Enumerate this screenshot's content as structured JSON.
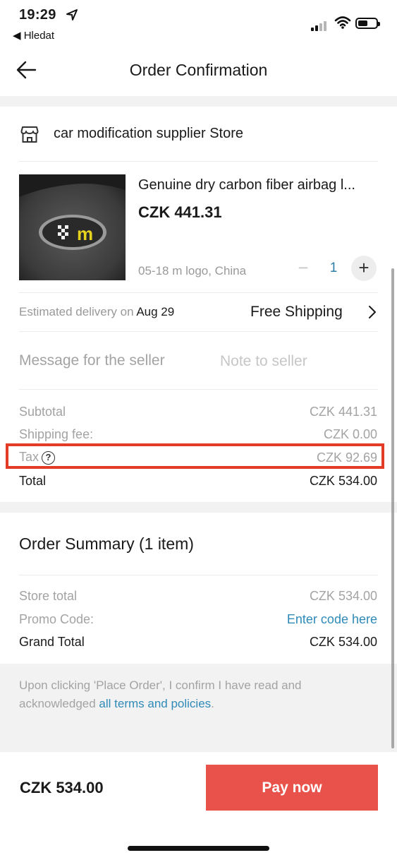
{
  "status_bar": {
    "time": "19:29",
    "back_app": "◀ Hledat"
  },
  "header": {
    "title": "Order Confirmation"
  },
  "store": {
    "name": "car modification supplier Store",
    "icon": "store-icon"
  },
  "product": {
    "title": "Genuine dry carbon fiber airbag l...",
    "price": "CZK 441.31",
    "variant": "05-18 m logo, China",
    "quantity": "1",
    "qty_minus": "−",
    "qty_plus": "+"
  },
  "delivery": {
    "label": "Estimated delivery on",
    "date": "Aug 29",
    "shipping": "Free Shipping"
  },
  "message": {
    "label": "Message for the seller",
    "placeholder": "Note to seller"
  },
  "totals": {
    "subtotal_label": "Subtotal",
    "subtotal": "CZK 441.31",
    "shipping_label": "Shipping fee:",
    "shipping": "CZK 0.00",
    "tax_label": "Tax",
    "tax_help": "?",
    "tax": "CZK 92.69",
    "total_label": "Total",
    "total": "CZK 534.00"
  },
  "summary": {
    "title": "Order Summary (1 item)",
    "store_total_label": "Store total",
    "store_total": "CZK 534.00",
    "promo_label": "Promo Code:",
    "promo_link": "Enter code here",
    "grand_total_label": "Grand Total",
    "grand_total": "CZK 534.00"
  },
  "terms": {
    "text": "Upon clicking 'Place Order', I confirm I have read and acknowledged ",
    "link": "all terms and policies",
    "end": "."
  },
  "bottom": {
    "total": "CZK 534.00",
    "pay_label": "Pay now"
  },
  "colors": {
    "pay_button": "#e8524a",
    "link": "#2f8ab8",
    "highlight": "#e23c26",
    "quantity": "#2c7fa8"
  }
}
